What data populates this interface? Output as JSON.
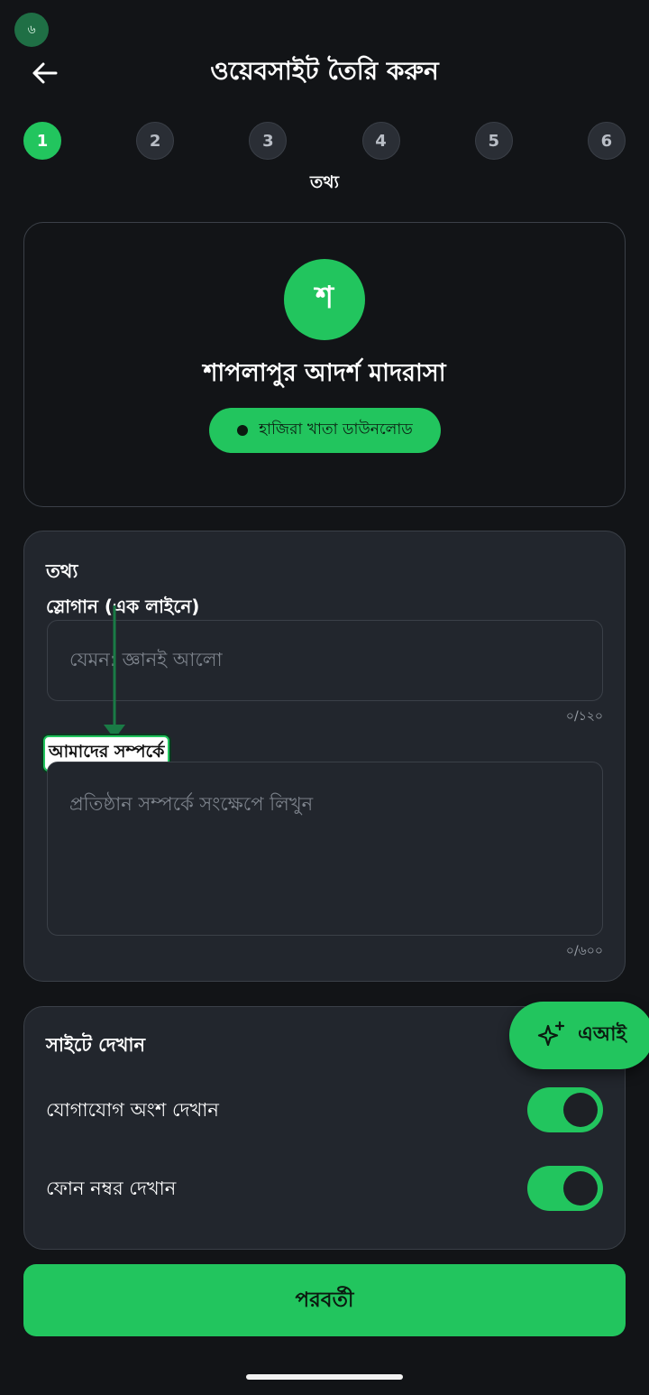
{
  "status": {
    "badge": "৬"
  },
  "header": {
    "title": "ওয়েবসাইট তৈরি করুন"
  },
  "stepper": {
    "steps": [
      "1",
      "2",
      "3",
      "4",
      "5",
      "6"
    ],
    "active_index": 0,
    "current_label": "তথ্য"
  },
  "profile": {
    "avatar_letter": "শ",
    "name": "শাপলাপুর আদর্শ মাদরাসা",
    "download_label": "হাজিরা খাতা ডাউনলোড"
  },
  "info": {
    "title": "তথ্য",
    "slogan": {
      "label": "স্লোগান (এক লাইনে)",
      "placeholder": "যেমন: জ্ঞানই আলো",
      "counter": "০/১২০"
    },
    "about": {
      "label": "আমাদের সম্পর্কে",
      "placeholder": "প্রতিষ্ঠান সম্পর্কে সংক্ষেপে লিখুন",
      "counter": "০/৬০০"
    }
  },
  "show_on_site": {
    "title": "সাইটে দেখান",
    "toggles": [
      {
        "label": "যোগাযোগ অংশ দেখান",
        "on": true
      },
      {
        "label": "ফোন নম্বর দেখান",
        "on": true
      }
    ]
  },
  "ai_button": {
    "label": "এআই"
  },
  "footer": {
    "next_label": "পরবর্তী"
  },
  "colors": {
    "accent": "#22c55e",
    "background": "#121417",
    "card": "#22262d"
  }
}
